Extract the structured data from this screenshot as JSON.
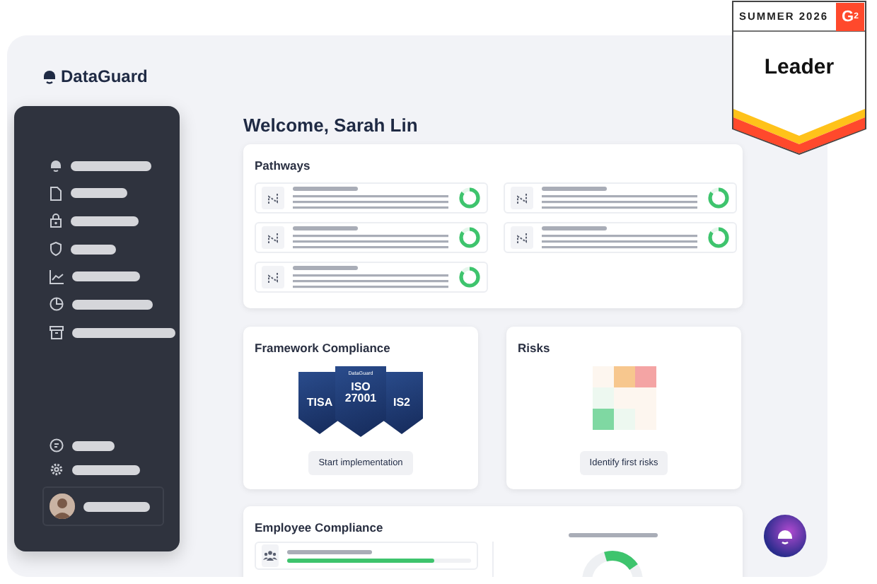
{
  "brand": {
    "name": "DataGuard"
  },
  "award": {
    "season": "SUMMER 2026",
    "logo": "G$^{2}$",
    "title": "Leader"
  },
  "sidebar": {
    "items": [
      {
        "kind": "mascot"
      },
      {
        "kind": "document"
      },
      {
        "kind": "lock"
      },
      {
        "kind": "shield"
      },
      {
        "kind": "chart"
      },
      {
        "kind": "clock"
      },
      {
        "kind": "archive"
      }
    ],
    "footer_items": [
      {
        "kind": "chat"
      },
      {
        "kind": "gear"
      }
    ]
  },
  "welcome": "Welcome, Sarah Lin",
  "pathways": {
    "title": "Pathways",
    "items": [
      {
        "level": 0.85
      },
      {
        "level": 0.85
      },
      {
        "level": 0.85
      },
      {
        "level": 0.85
      },
      {
        "level": 0.85
      }
    ]
  },
  "framework": {
    "title": "Framework Compliance",
    "badges": [
      {
        "label": "TISA"
      },
      {
        "brand": "DataGuard",
        "label": "ISO 27001"
      },
      {
        "label": "IS2"
      }
    ],
    "button": "Start implementation"
  },
  "risks": {
    "title": "Risks",
    "cells": [
      {
        "color": "#fdf6ef"
      },
      {
        "color": "#f7c78e"
      },
      {
        "color": "#f4a4a4"
      },
      {
        "color": "#edf8f0"
      },
      {
        "color": "#fdf6ef"
      },
      {
        "color": "#fdf6ef"
      },
      {
        "color": "#7fd8a2"
      },
      {
        "color": "#edf8f0"
      },
      {
        "color": "#fdf6ef"
      }
    ],
    "button": "Identify first risks"
  },
  "employee_compliance": {
    "title": "Employee Compliance",
    "items": [
      {
        "level": 0.8
      }
    ]
  }
}
